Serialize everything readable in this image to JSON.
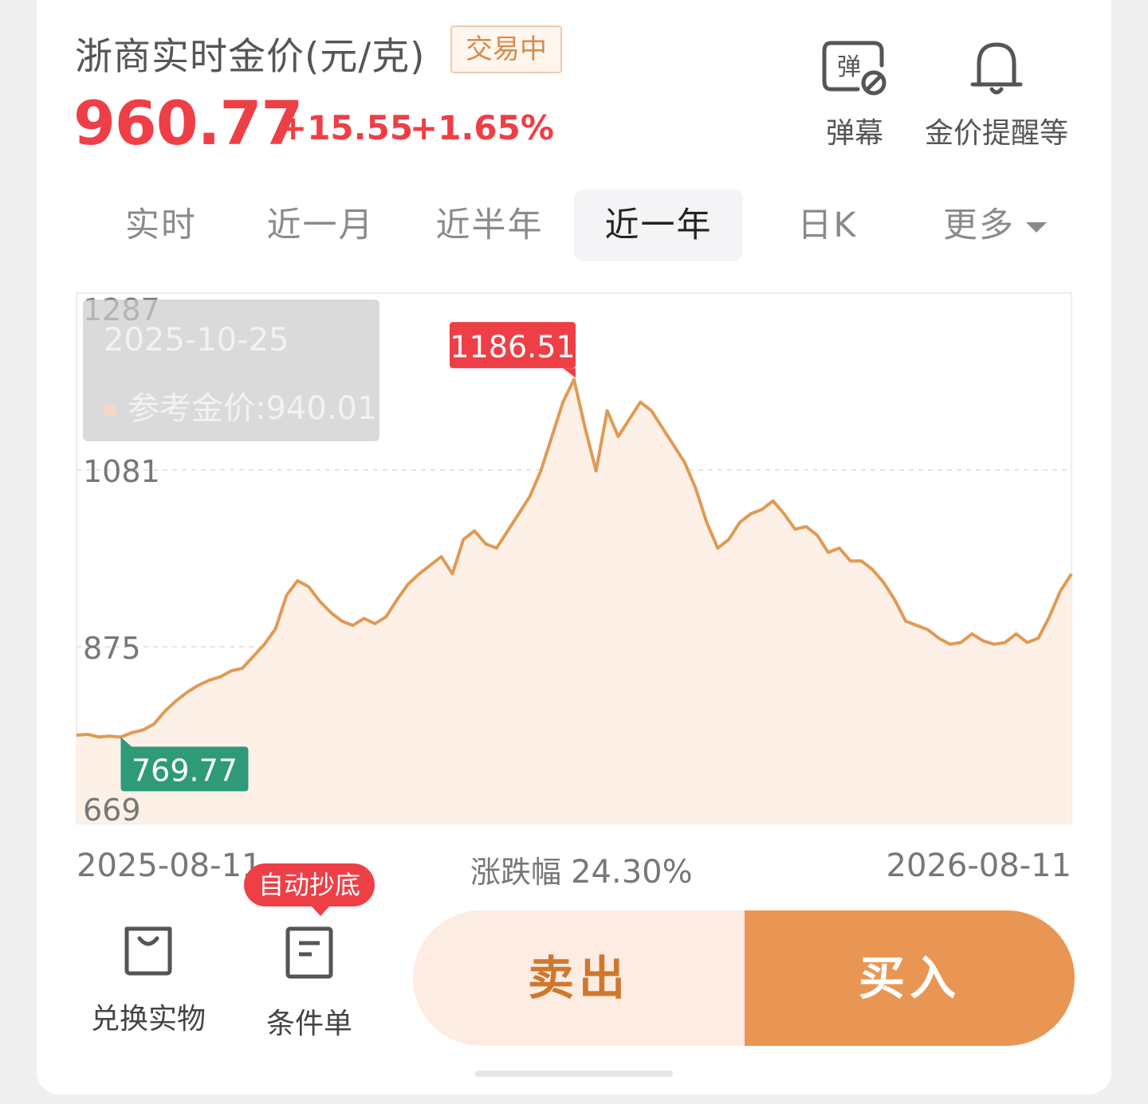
{
  "header": {
    "title": "浙商实时金价(元/克)",
    "status_badge": "交易中",
    "price": "960.77",
    "change_abs": "+15.55",
    "change_pct": "+1.65%"
  },
  "top_actions": {
    "danmu_label": "弹幕",
    "danmu_icon_text": "弹",
    "alert_label": "金价提醒等"
  },
  "tabs": [
    {
      "label": "实时"
    },
    {
      "label": "近一月"
    },
    {
      "label": "近半年"
    },
    {
      "label": "近一年",
      "active": true
    },
    {
      "label": "日K"
    },
    {
      "label": "更多"
    }
  ],
  "tooltip": {
    "date": "2025-10-25",
    "label": "参考金价:940.01"
  },
  "chart_data": {
    "type": "area",
    "y_ticks": [
      "1287",
      "1081",
      "875",
      "669"
    ],
    "ylim": [
      669,
      1287
    ],
    "x_labels": [
      "2025-08-11",
      "2026-08-11"
    ],
    "line_color": "#e09a55",
    "fill_color": "#fdf1e7",
    "max_label": "1186.51",
    "min_label": "769.77",
    "range_change_label": "涨跌幅",
    "range_change_value": "24.30%",
    "series": [
      {
        "values": [
          772,
          773,
          770,
          771,
          769.77,
          775,
          778,
          785,
          800,
          812,
          822,
          830,
          836,
          840,
          847,
          850,
          864,
          878,
          896,
          935,
          952,
          945,
          928,
          915,
          905,
          900,
          908,
          902,
          910,
          930,
          948,
          960,
          970,
          980,
          960,
          1000,
          1010,
          995,
          990,
          1010,
          1030,
          1050,
          1080,
          1120,
          1160,
          1186.51,
          1130,
          1080,
          1150,
          1120,
          1140,
          1160,
          1150,
          1130,
          1110,
          1090,
          1060,
          1020,
          990,
          1000,
          1020,
          1030,
          1035,
          1045,
          1030,
          1012,
          1015,
          1005,
          985,
          990,
          975,
          975,
          965,
          950,
          930,
          905,
          900,
          895,
          885,
          878,
          880,
          890,
          882,
          878,
          880,
          890,
          880,
          885,
          910,
          940,
          960
        ]
      }
    ]
  },
  "bottom": {
    "exchange_label": "兑换实物",
    "conditional_label": "条件单",
    "promo_tag": "自动抄底",
    "sell_label": "卖出",
    "buy_label": "买入"
  }
}
